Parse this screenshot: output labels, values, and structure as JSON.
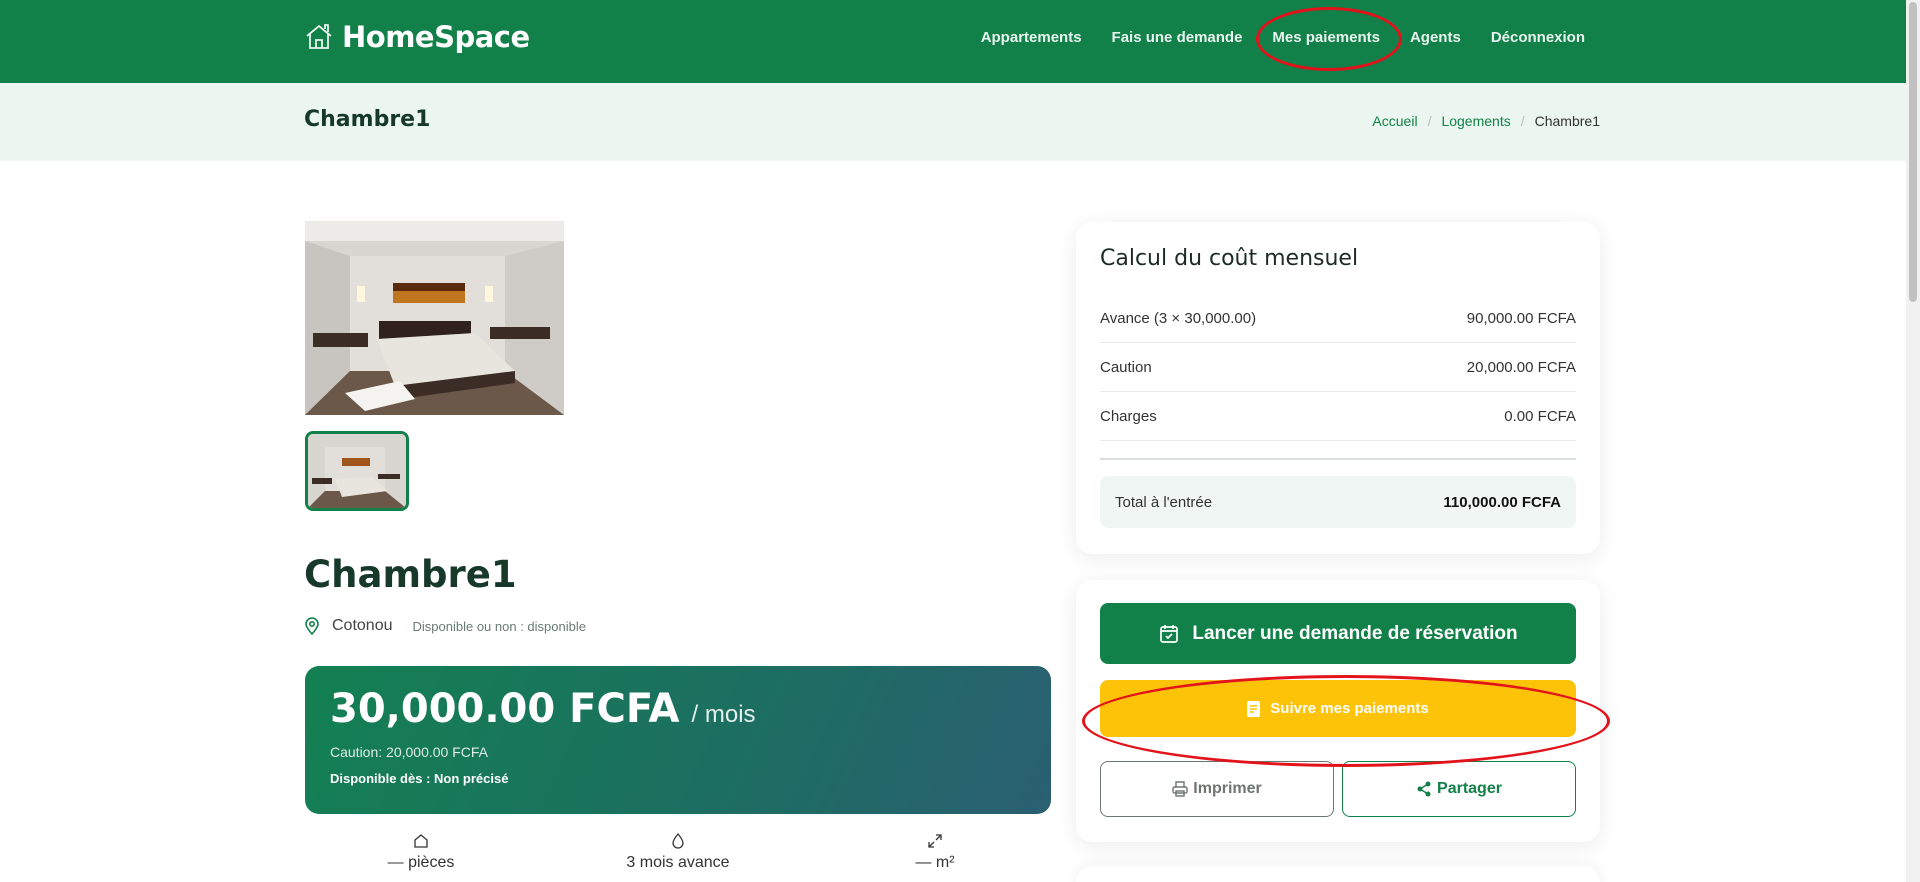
{
  "navbar": {
    "brand": "HomeSpace",
    "links": [
      "Appartements",
      "Fais une demande",
      "Mes paiements",
      "Agents",
      "Déconnexion"
    ]
  },
  "header": {
    "title": "Chambre1",
    "breadcrumb": [
      "Accueil",
      "Logements",
      "Chambre1"
    ]
  },
  "listing": {
    "title": "Chambre1",
    "city": "Cotonou",
    "availability": "Disponible ou non : disponible",
    "price": "30,000.00 FCFA",
    "period": "/ mois",
    "caution": "Caution: 20,000.00 FCFA",
    "available_from": "Disponible dès : Non précisé",
    "features": [
      "— pièces",
      "3 mois avance",
      "— m²"
    ]
  },
  "cost": {
    "title": "Calcul du coût mensuel",
    "rows": [
      {
        "label": "Avance (3 × 30,000.00)",
        "value": "90,000.00 FCFA"
      },
      {
        "label": "Caution",
        "value": "20,000.00 FCFA"
      },
      {
        "label": "Charges",
        "value": "0.00 FCFA"
      }
    ],
    "total_label": "Total à l'entrée",
    "total_value": "110,000.00 FCFA"
  },
  "actions": {
    "reserve": "Lancer une demande de réservation",
    "track": "Suivre mes paiements",
    "print": "Imprimer",
    "share": "Partager"
  },
  "colors": {
    "primary": "#128049",
    "accent": "#fdc309",
    "annotation": "#e3131b"
  }
}
